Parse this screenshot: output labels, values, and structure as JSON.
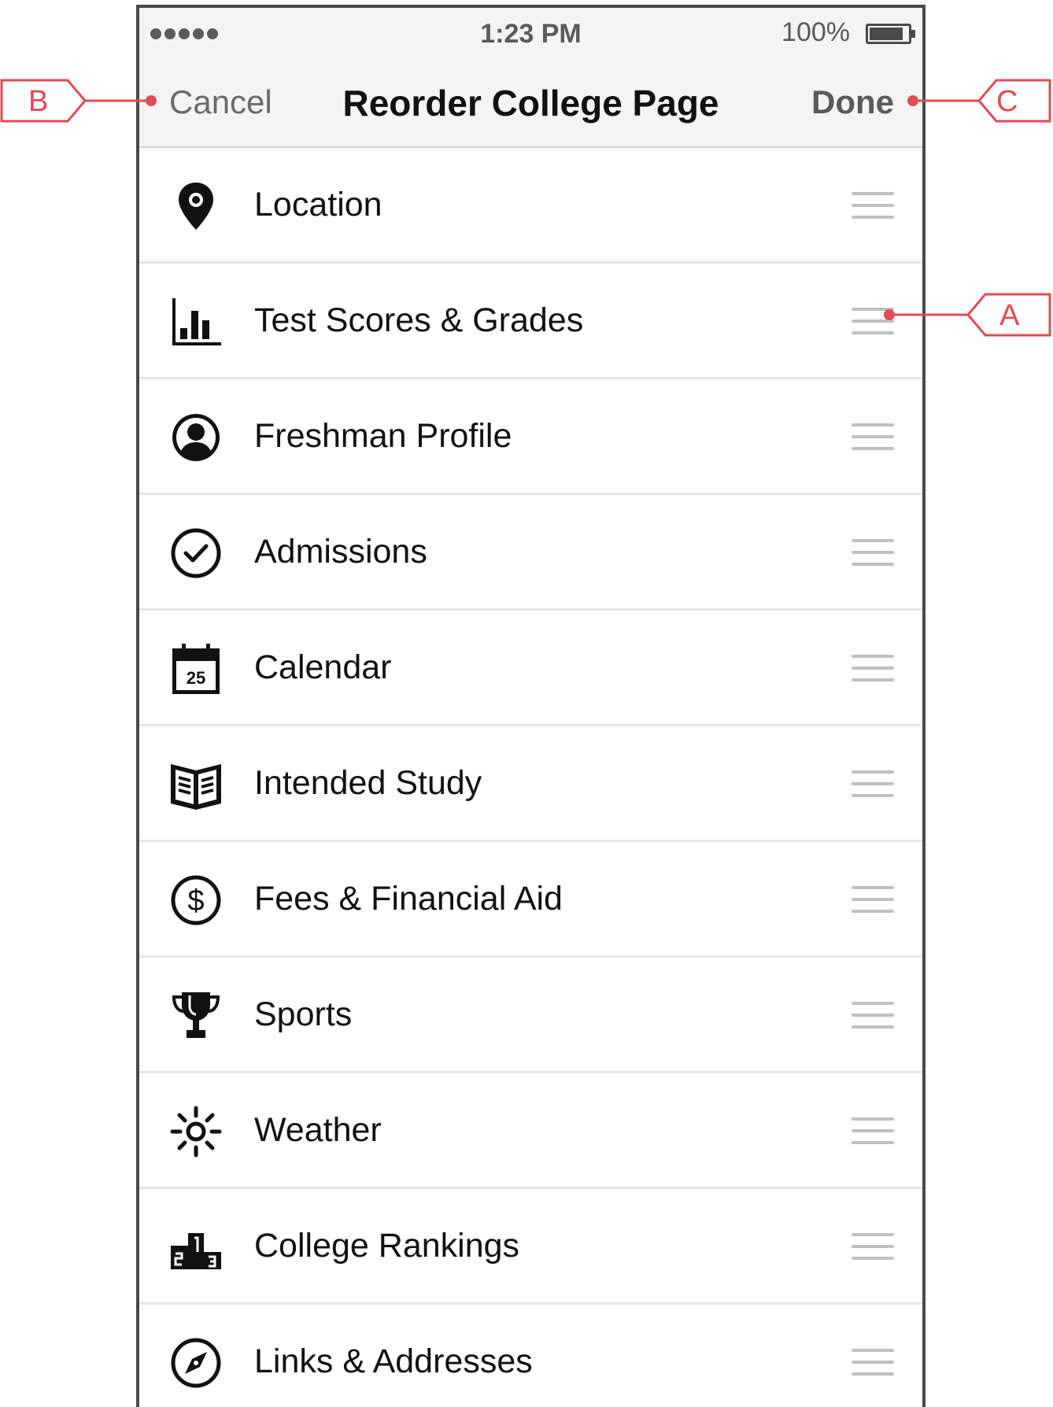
{
  "status_bar": {
    "time": "1:23 PM",
    "battery_percent": "100%",
    "signal_dots": 5
  },
  "nav": {
    "cancel_label": "Cancel",
    "title": "Reorder College Page",
    "done_label": "Done"
  },
  "items": [
    {
      "label": "Location",
      "icon": "map-pin-icon"
    },
    {
      "label": "Test Scores & Grades",
      "icon": "bar-chart-icon"
    },
    {
      "label": "Freshman Profile",
      "icon": "user-circle-icon"
    },
    {
      "label": "Admissions",
      "icon": "check-circle-icon"
    },
    {
      "label": "Calendar",
      "icon": "calendar-icon",
      "icon_text": "25"
    },
    {
      "label": "Intended Study",
      "icon": "book-icon"
    },
    {
      "label": "Fees & Financial Aid",
      "icon": "dollar-circle-icon",
      "icon_text": "$"
    },
    {
      "label": "Sports",
      "icon": "trophy-icon"
    },
    {
      "label": "Weather",
      "icon": "sun-icon"
    },
    {
      "label": "College Rankings",
      "icon": "podium-icon"
    },
    {
      "label": "Links & Addresses",
      "icon": "compass-icon"
    }
  ],
  "annotations": {
    "a": "A",
    "b": "B",
    "c": "C",
    "color": "#e04b55"
  }
}
